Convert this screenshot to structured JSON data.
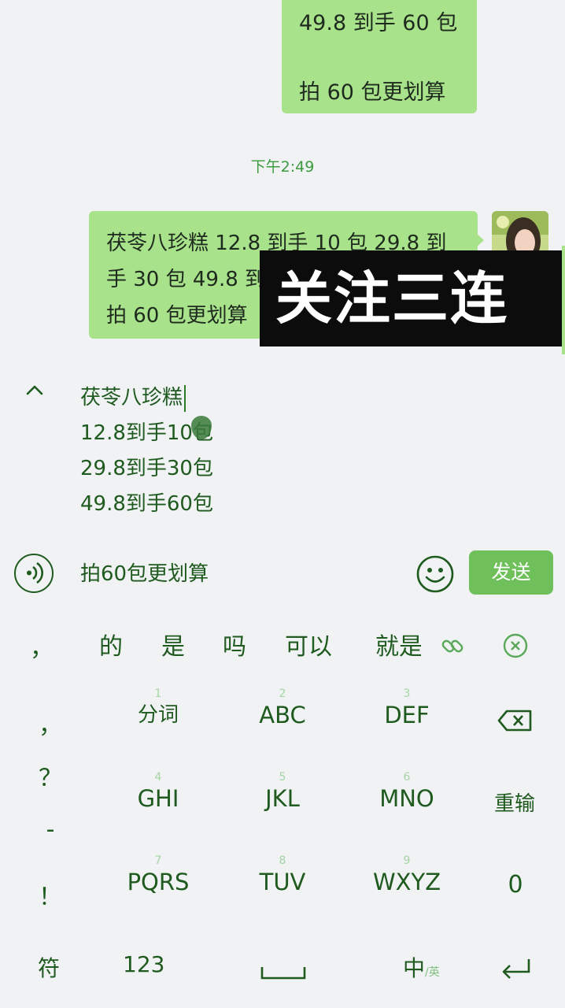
{
  "chat": {
    "top_bubble": {
      "line1": "49.8 到手 60 包",
      "line2": "拍 60 包更划算"
    },
    "timestamp": "下午2:49",
    "main_bubble": {
      "line1": "茯苓八珍糕 12.8 到手 10 包 29.8 到",
      "line2": "手 30 包 49.8 到",
      "line3": "拍 60 包更划算"
    }
  },
  "overlay": {
    "text": "关注三连"
  },
  "draft": {
    "lines": [
      "茯苓八珍糕",
      "12.8到手10包",
      "29.8到手30包",
      "49.8到手60包"
    ]
  },
  "input_row": {
    "text": "拍60包更划算",
    "send_label": "发送"
  },
  "candidates": {
    "comma": "，",
    "items": [
      "的",
      "是",
      "吗",
      "可以",
      "就是"
    ]
  },
  "keyboard": {
    "symbols": [
      "，",
      "？",
      "-",
      "！"
    ],
    "rows": [
      [
        {
          "num": "1",
          "label": "分词"
        },
        {
          "num": "2",
          "label": "ABC"
        },
        {
          "num": "3",
          "label": "DEF"
        }
      ],
      [
        {
          "num": "4",
          "label": "GHI"
        },
        {
          "num": "5",
          "label": "JKL"
        },
        {
          "num": "6",
          "label": "MNO"
        }
      ],
      [
        {
          "num": "7",
          "label": "PQRS"
        },
        {
          "num": "8",
          "label": "TUV"
        },
        {
          "num": "9",
          "label": "WXYZ"
        }
      ]
    ],
    "retype": "重输",
    "zero": "0",
    "symbol_key": "符",
    "number_key": "123",
    "lang_main": "中",
    "lang_sub": "/英"
  },
  "colors": {
    "bubble": "#a8e28a",
    "accent": "#6fbf5a",
    "text": "#1f5a1f"
  },
  "icons": [
    "chevron-up-icon",
    "voice-icon",
    "emoji-icon",
    "link-icon",
    "close-circle-icon",
    "backspace-icon",
    "space-icon",
    "enter-icon"
  ]
}
